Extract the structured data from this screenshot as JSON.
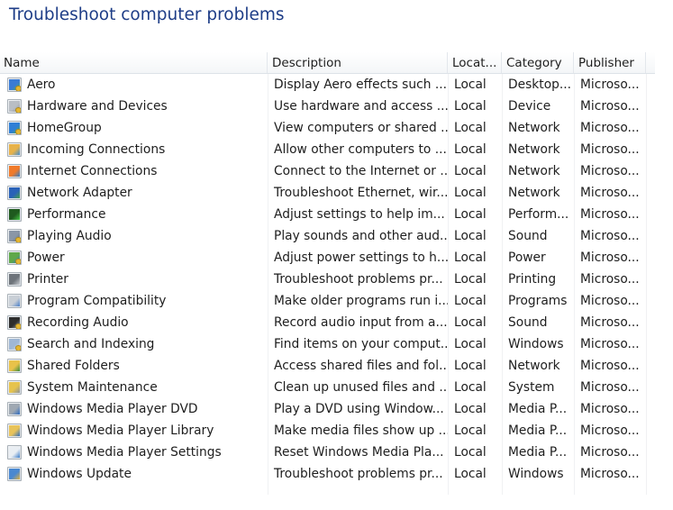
{
  "page": {
    "title": "Troubleshoot computer problems"
  },
  "columns": {
    "name": "Name",
    "description": "Description",
    "location": "Locat...",
    "category": "Category",
    "publisher": "Publisher"
  },
  "rows": [
    {
      "name": "Aero",
      "description": "Display Aero effects such ...",
      "location": "Local",
      "category": "Desktop...",
      "publisher": "Microso...",
      "icon": "aero-icon",
      "color": "#3a7bd5",
      "accent": "#4caf50",
      "shield": true
    },
    {
      "name": "Hardware and Devices",
      "description": "Use hardware and access ...",
      "location": "Local",
      "category": "Device",
      "publisher": "Microso...",
      "icon": "hardware-icon",
      "color": "#b9bec4",
      "accent": "#8a9099",
      "shield": true
    },
    {
      "name": "HomeGroup",
      "description": "View computers or shared ...",
      "location": "Local",
      "category": "Network",
      "publisher": "Microso...",
      "icon": "homegroup-icon",
      "color": "#2f7fd6",
      "accent": "#4cae3f",
      "shield": true
    },
    {
      "name": "Incoming Connections",
      "description": "Allow other computers to ...",
      "location": "Local",
      "category": "Network",
      "publisher": "Microso...",
      "icon": "incoming-connections-icon",
      "color": "#e7b24a",
      "accent": "#3e8ed8",
      "shield": false
    },
    {
      "name": "Internet Connections",
      "description": "Connect to the Internet or ...",
      "location": "Local",
      "category": "Network",
      "publisher": "Microso...",
      "icon": "internet-connections-icon",
      "color": "#f07a2a",
      "accent": "#2a7fd0",
      "shield": false
    },
    {
      "name": "Network Adapter",
      "description": "Troubleshoot Ethernet, wir...",
      "location": "Local",
      "category": "Network",
      "publisher": "Microso...",
      "icon": "network-adapter-icon",
      "color": "#2a62b8",
      "accent": "#45a04a",
      "shield": false
    },
    {
      "name": "Performance",
      "description": "Adjust settings to help im...",
      "location": "Local",
      "category": "Perform...",
      "publisher": "Microso...",
      "icon": "performance-icon",
      "color": "#1f5a1f",
      "accent": "#46c646",
      "shield": false
    },
    {
      "name": "Playing Audio",
      "description": "Play sounds and other aud...",
      "location": "Local",
      "category": "Sound",
      "publisher": "Microso...",
      "icon": "playing-audio-icon",
      "color": "#8a96a6",
      "accent": "#5c6b7c",
      "shield": true
    },
    {
      "name": "Power",
      "description": "Adjust power settings to h...",
      "location": "Local",
      "category": "Power",
      "publisher": "Microso...",
      "icon": "power-icon",
      "color": "#5fa84a",
      "accent": "#2e6fc4",
      "shield": true
    },
    {
      "name": "Printer",
      "description": "Troubleshoot problems pr...",
      "location": "Local",
      "category": "Printing",
      "publisher": "Microso...",
      "icon": "printer-icon",
      "color": "#6d737a",
      "accent": "#c9cdd2",
      "shield": false
    },
    {
      "name": "Program Compatibility",
      "description": "Make older programs run i...",
      "location": "Local",
      "category": "Programs",
      "publisher": "Microso...",
      "icon": "program-compatibility-icon",
      "color": "#c9cfd6",
      "accent": "#4a7fc8",
      "shield": false
    },
    {
      "name": "Recording Audio",
      "description": "Record audio input from a...",
      "location": "Local",
      "category": "Sound",
      "publisher": "Microso...",
      "icon": "recording-audio-icon",
      "color": "#2d2d2d",
      "accent": "#9aa3ad",
      "shield": true
    },
    {
      "name": "Search and Indexing",
      "description": "Find items on your comput...",
      "location": "Local",
      "category": "Windows",
      "publisher": "Microso...",
      "icon": "search-indexing-icon",
      "color": "#9fb7d4",
      "accent": "#d8dde3",
      "shield": true
    },
    {
      "name": "Shared Folders",
      "description": "Access shared files and fol...",
      "location": "Local",
      "category": "Network",
      "publisher": "Microso...",
      "icon": "shared-folders-icon",
      "color": "#e8c24a",
      "accent": "#3c8c3c",
      "shield": false
    },
    {
      "name": "System Maintenance",
      "description": "Clean up unused files and ...",
      "location": "Local",
      "category": "System",
      "publisher": "Microso...",
      "icon": "system-maintenance-icon",
      "color": "#e6c34d",
      "accent": "#8d949c",
      "shield": false
    },
    {
      "name": "Windows Media Player DVD",
      "description": "Play a DVD using Window...",
      "location": "Local",
      "category": "Media P...",
      "publisher": "Microso...",
      "icon": "wmp-dvd-icon",
      "color": "#9fa8b2",
      "accent": "#2e6cc0",
      "shield": false
    },
    {
      "name": "Windows Media Player Library",
      "description": "Make media files show up ...",
      "location": "Local",
      "category": "Media P...",
      "publisher": "Microso...",
      "icon": "wmp-library-icon",
      "color": "#e8c35a",
      "accent": "#2d6fc4",
      "shield": false
    },
    {
      "name": "Windows Media Player Settings",
      "description": "Reset Windows Media Pla...",
      "location": "Local",
      "category": "Media P...",
      "publisher": "Microso...",
      "icon": "wmp-settings-icon",
      "color": "#e9eef3",
      "accent": "#3a7bc8",
      "shield": false
    },
    {
      "name": "Windows Update",
      "description": "Troubleshoot problems pr...",
      "location": "Local",
      "category": "Windows",
      "publisher": "Microso...",
      "icon": "windows-update-icon",
      "color": "#4a88d0",
      "accent": "#e3b23c",
      "shield": false
    }
  ]
}
